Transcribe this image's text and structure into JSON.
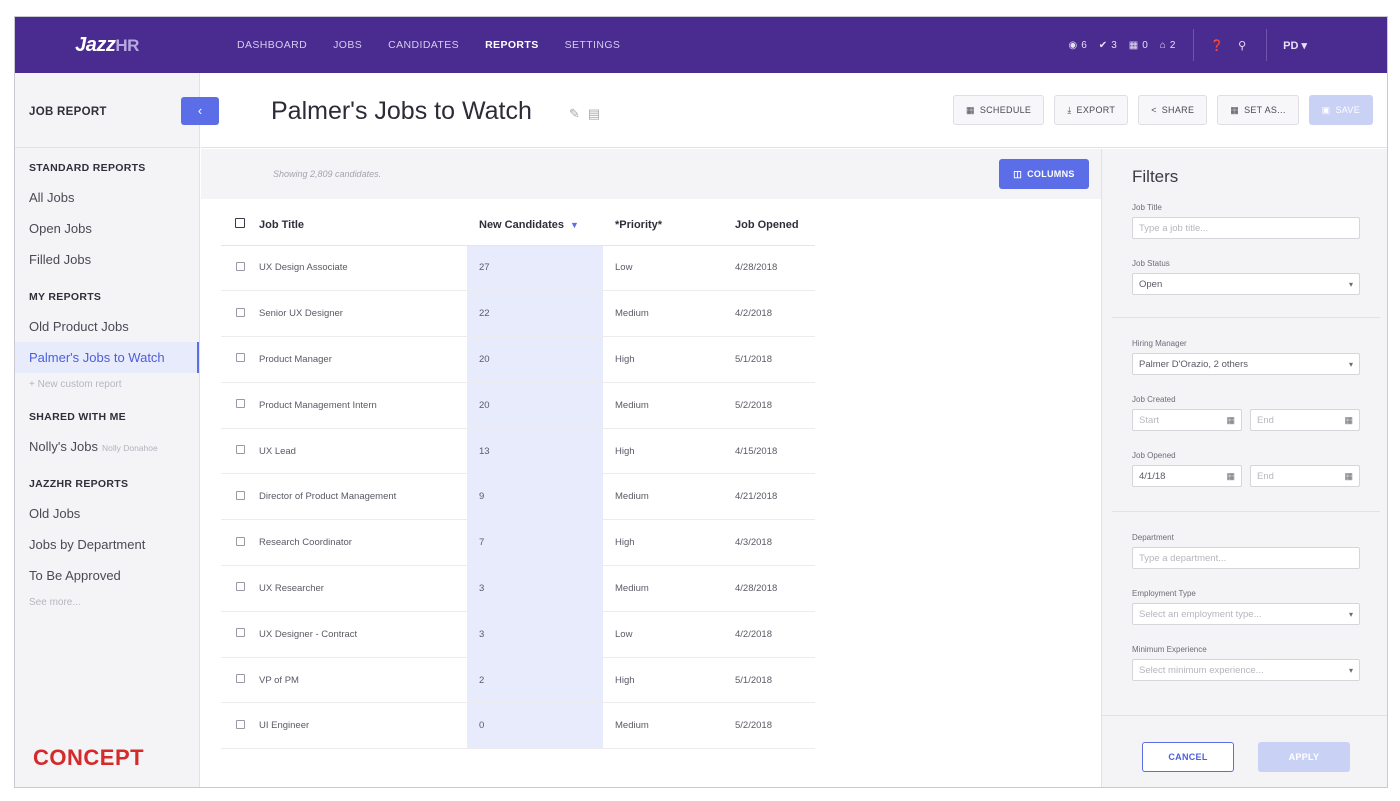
{
  "nav": {
    "logo": "Jazz",
    "logo_suffix": "HR",
    "links": [
      "DASHBOARD",
      "JOBS",
      "CANDIDATES",
      "REPORTS",
      "SETTINGS"
    ],
    "stats": [
      {
        "icon": "eye-icon",
        "glyph": "◉",
        "count": "6"
      },
      {
        "icon": "check-icon",
        "glyph": "✔",
        "count": "3"
      },
      {
        "icon": "calendar-icon",
        "glyph": "▦",
        "count": "0"
      },
      {
        "icon": "inbox-icon",
        "glyph": "⌂",
        "count": "2"
      }
    ],
    "help_glyph": "❓",
    "search_glyph": "⚲",
    "user": "PD ▾"
  },
  "sidebar": {
    "title": "JOB REPORT",
    "collapse": "‹",
    "standard_title": "STANDARD REPORTS",
    "standard": [
      "All Jobs",
      "Open Jobs",
      "Filled Jobs"
    ],
    "my_title": "MY REPORTS",
    "my": [
      "Old Product Jobs",
      "Palmer's Jobs to Watch"
    ],
    "new_custom": "+ New custom report",
    "shared_title": "SHARED WITH ME",
    "shared_item": "Nolly's Jobs",
    "shared_owner": "Nolly Donahoe",
    "jazz_title": "JAZZHR REPORTS",
    "jazz": [
      "Old Jobs",
      "Jobs by Department",
      "To Be Approved"
    ],
    "see_more": "See more...",
    "concept": "CONCEPT"
  },
  "header": {
    "title": "Palmer's Jobs to Watch",
    "edit_glyph": "✎",
    "archive_glyph": "▤",
    "actions": [
      {
        "glyph": "▦",
        "label": "SCHEDULE"
      },
      {
        "glyph": "⤓",
        "label": "EXPORT"
      },
      {
        "glyph": "<",
        "label": "SHARE"
      },
      {
        "glyph": "▦",
        "label": "SET AS..."
      },
      {
        "glyph": "▣",
        "label": "SAVE"
      }
    ]
  },
  "table": {
    "showing": "Showing 2,809 candidates.",
    "columns_btn": "COLUMNS",
    "columns_glyph": "◫",
    "headers": [
      "Job Title",
      "New Candidates",
      "*Priority*",
      "Job Opened"
    ],
    "sort_glyph": "▼",
    "rows": [
      [
        "UX Design Associate",
        "27",
        "Low",
        "4/28/2018"
      ],
      [
        "Senior UX Designer",
        "22",
        "Medium",
        "4/2/2018"
      ],
      [
        "Product Manager",
        "20",
        "High",
        "5/1/2018"
      ],
      [
        "Product Management Intern",
        "20",
        "Medium",
        "5/2/2018"
      ],
      [
        "UX Lead",
        "13",
        "High",
        "4/15/2018"
      ],
      [
        "Director of Product Management",
        "9",
        "Medium",
        "4/21/2018"
      ],
      [
        "Research Coordinator",
        "7",
        "High",
        "4/3/2018"
      ],
      [
        "UX Researcher",
        "3",
        "Medium",
        "4/28/2018"
      ],
      [
        "UX Designer - Contract",
        "3",
        "Low",
        "4/2/2018"
      ],
      [
        "VP of PM",
        "2",
        "High",
        "5/1/2018"
      ],
      [
        "UI Engineer",
        "0",
        "Medium",
        "5/2/2018"
      ]
    ]
  },
  "filters": {
    "title": "Filters",
    "job_title_label": "Job Title",
    "job_title_placeholder": "Type a job title...",
    "job_status_label": "Job Status",
    "job_status_value": "Open",
    "hiring_manager_label": "Hiring Manager",
    "hiring_manager_value": "Palmer D'Orazio, 2 others",
    "job_created_label": "Job Created",
    "start_placeholder": "Start",
    "end_placeholder": "End",
    "job_opened_label": "Job Opened",
    "job_opened_start": "4/1/18",
    "department_label": "Department",
    "department_placeholder": "Type a department...",
    "employment_label": "Employment Type",
    "employment_placeholder": "Select an employment type...",
    "experience_label": "Minimum Experience",
    "experience_placeholder": "Select minimum experience...",
    "caret": "▾",
    "cal_glyph": "▦",
    "cancel": "CANCEL",
    "apply": "APPLY"
  },
  "colors": {
    "nav_bg": "#4a2b8f",
    "accent": "#5b6ee8",
    "concept": "#d42a2a"
  }
}
